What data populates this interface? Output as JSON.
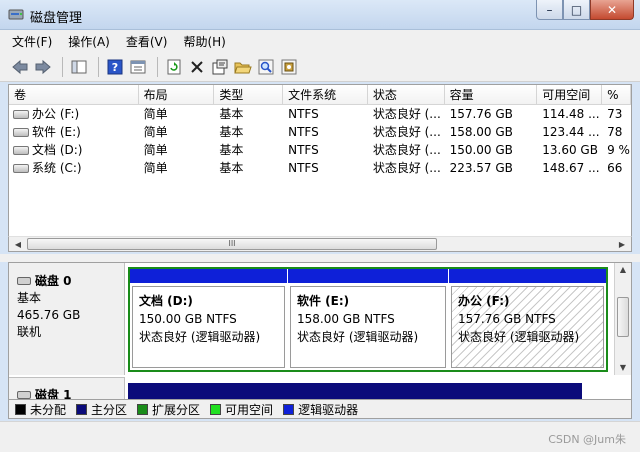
{
  "window": {
    "title": "磁盘管理"
  },
  "menu": [
    "文件(F)",
    "操作(A)",
    "查看(V)",
    "帮助(H)"
  ],
  "toolbar_icons": [
    "back-arrow-icon",
    "forward-arrow-icon",
    "console-tree-icon",
    "help-icon",
    "properties-icon",
    "refresh-icon",
    "delete-icon",
    "settings-icon",
    "open-folder-icon",
    "search-icon",
    "export-icon"
  ],
  "volume_table": {
    "columns": [
      "卷",
      "布局",
      "类型",
      "文件系统",
      "状态",
      "容量",
      "可用空间",
      "%"
    ],
    "rows": [
      [
        "办公 (F:)",
        "简单",
        "基本",
        "NTFS",
        "状态良好 (...",
        "157.76 GB",
        "114.48 ...",
        "73"
      ],
      [
        "软件 (E:)",
        "简单",
        "基本",
        "NTFS",
        "状态良好 (...",
        "158.00 GB",
        "123.44 ...",
        "78"
      ],
      [
        "文档 (D:)",
        "简单",
        "基本",
        "NTFS",
        "状态良好 (...",
        "150.00 GB",
        "13.60 GB",
        "9 %"
      ],
      [
        "系统 (C:)",
        "简单",
        "基本",
        "NTFS",
        "状态良好 (...",
        "223.57 GB",
        "148.67 ...",
        "66"
      ]
    ]
  },
  "scrollbar": {
    "grip": "III"
  },
  "disk0": {
    "title": "磁盘 0",
    "type": "基本",
    "size": "465.76 GB",
    "status": "联机",
    "partitions": [
      {
        "name": "文档  (D:)",
        "size": "150.00 GB NTFS",
        "status": "状态良好 (逻辑驱动器)"
      },
      {
        "name": "软件  (E:)",
        "size": "158.00 GB NTFS",
        "status": "状态良好 (逻辑驱动器)"
      },
      {
        "name": "办公  (F:)",
        "size": "157.76 GB NTFS",
        "status": "状态良好 (逻辑驱动器)"
      }
    ]
  },
  "disk1": {
    "title": "磁盘 1"
  },
  "legend": [
    {
      "label": "未分配",
      "color": "#000000"
    },
    {
      "label": "主分区",
      "color": "#0b0b7a"
    },
    {
      "label": "扩展分区",
      "color": "#1a8c1a"
    },
    {
      "label": "可用空间",
      "color": "#22e022"
    },
    {
      "label": "逻辑驱动器",
      "color": "#0e20d8"
    }
  ],
  "watermark": "CSDN @Jum朱"
}
